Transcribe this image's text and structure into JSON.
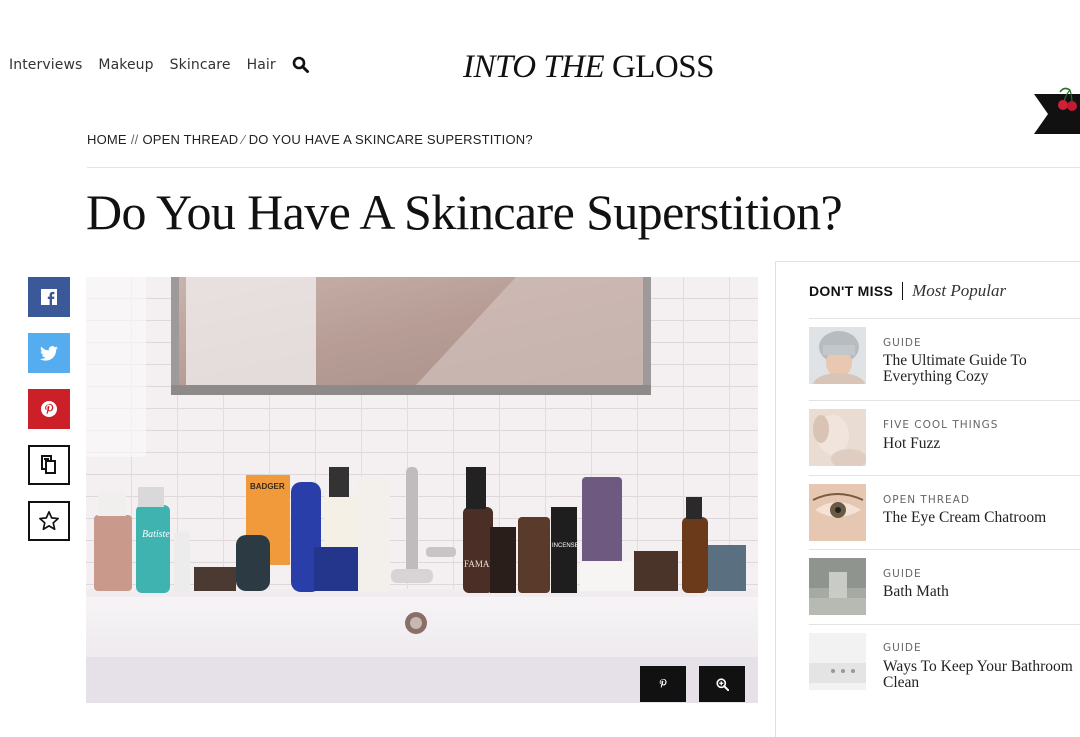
{
  "nav": {
    "items": [
      "Interviews",
      "Makeup",
      "Skincare",
      "Hair"
    ],
    "search_icon": "search-icon"
  },
  "logo": {
    "part1": "INTO THE",
    "part2": "GLOSS"
  },
  "breadcrumb": [
    "HOME",
    "OPEN THREAD",
    "DO YOU HAVE A SKINCARE SUPERSTITION?"
  ],
  "breadcrumb_separator": "//",
  "article": {
    "title": "Do You Have A Skincare Superstition?"
  },
  "share": {
    "icons": [
      "facebook-icon",
      "twitter-icon",
      "pinterest-icon",
      "copy-icon",
      "star-icon"
    ],
    "colors": {
      "facebook": "#3b5998",
      "twitter": "#55acee",
      "pinterest": "#cb2027"
    }
  },
  "hero": {
    "bottle_labels": [
      "BADGER",
      "Batiste",
      "FAMAN",
      "INCENSE"
    ],
    "actions": [
      "pin-icon",
      "zoom-icon"
    ]
  },
  "sidebar": {
    "tab_active": "DON'T MISS",
    "tab_inactive": "Most Popular",
    "items": [
      {
        "category": "GUIDE",
        "title": "The Ultimate Guide To Everything Cozy"
      },
      {
        "category": "FIVE COOL THINGS",
        "title": "Hot Fuzz"
      },
      {
        "category": "OPEN THREAD",
        "title": "The Eye Cream Chatroom"
      },
      {
        "category": "GUIDE",
        "title": "Bath Math"
      },
      {
        "category": "GUIDE",
        "title": "Ways To Keep Your Bathroom Clean"
      }
    ]
  }
}
